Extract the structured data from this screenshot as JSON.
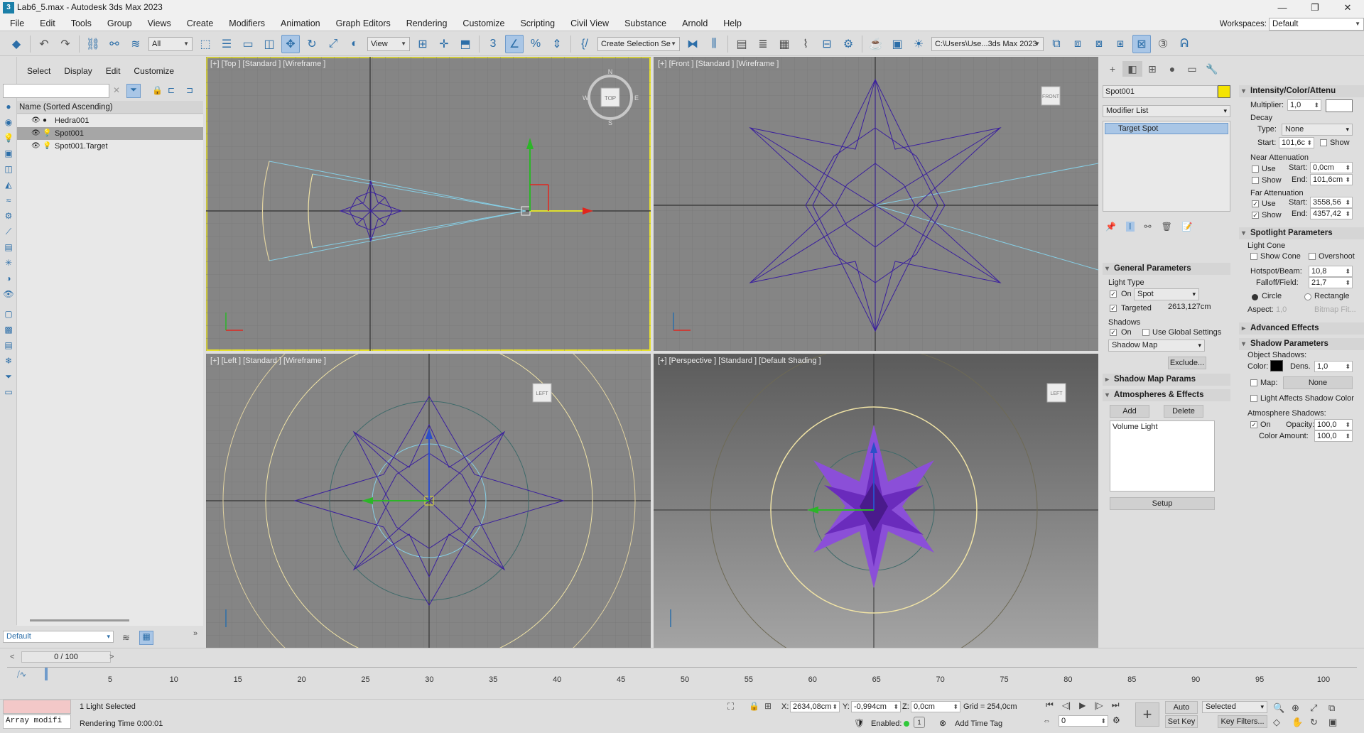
{
  "window": {
    "title": "Lab6_5.max - Autodesk 3ds Max 2023"
  },
  "menu": [
    "File",
    "Edit",
    "Tools",
    "Group",
    "Views",
    "Create",
    "Modifiers",
    "Animation",
    "Graph Editors",
    "Rendering",
    "Customize",
    "Scripting",
    "Civil View",
    "Substance",
    "Arnold",
    "Help"
  ],
  "workspace": {
    "label": "Workspaces:",
    "value": "Default"
  },
  "toolbar": {
    "filter": "All",
    "ref_coord": "View",
    "selection_set": "Create Selection Se",
    "project_path": "C:\\Users\\Use...3ds Max 2023"
  },
  "scene_explorer": {
    "tabs": [
      "Select",
      "Display",
      "Edit",
      "Customize"
    ],
    "header": "Name (Sorted Ascending)",
    "items": [
      {
        "name": "Hedra001",
        "selected": false
      },
      {
        "name": "Spot001",
        "selected": true
      },
      {
        "name": "Spot001.Target",
        "selected": false
      }
    ],
    "layer": "Default"
  },
  "viewports": {
    "top": {
      "label": "[+] [Top ] [Standard ] [Wireframe ]",
      "cube": "TOP",
      "compass": {
        "n": "N",
        "s": "S",
        "e": "E",
        "w": "W"
      }
    },
    "front": {
      "label": "[+] [Front ] [Standard ] [Wireframe ]",
      "cube": "FRONT"
    },
    "left": {
      "label": "[+] [Left ] [Standard ] [Wireframe ]",
      "cube": "LEFT"
    },
    "perspective": {
      "label": "[+] [Perspective ] [Standard ] [Default Shading ]",
      "cube": "LEFT"
    }
  },
  "command_panel": {
    "object_name": "Spot001",
    "object_color": "#f5e400",
    "modifier_list": "Modifier List",
    "stack_item": "Target Spot",
    "general": {
      "title": "General Parameters",
      "light_type": "Light Type",
      "on": "On",
      "type": "Spot",
      "targeted": "Targeted",
      "target_dist": "2613,127cm",
      "shadows": "Shadows",
      "shadows_on": "On",
      "use_global": "Use Global Settings",
      "shadow_type": "Shadow Map",
      "exclude": "Exclude..."
    },
    "rollouts_closed": [
      "Shadow Map Params"
    ],
    "atmos": {
      "title": "Atmospheres & Effects",
      "add": "Add",
      "delete": "Delete",
      "list_item": "Volume Light",
      "setup": "Setup"
    },
    "intensity": {
      "title": "Intensity/Color/Attenu",
      "multiplier_label": "Multiplier:",
      "multiplier": "1,0",
      "decay": "Decay",
      "type_label": "Type:",
      "type": "None",
      "start_label": "Start:",
      "start": "101,6c",
      "show": "Show",
      "near": "Near Attenuation",
      "near_use": "Use",
      "near_show": "Show",
      "near_start_label": "Start:",
      "near_start": "0,0cm",
      "near_end_label": "End:",
      "near_end": "101,6cm",
      "far": "Far Attenuation",
      "far_use": "Use",
      "far_show": "Show",
      "far_start_label": "Start:",
      "far_start": "3558,56",
      "far_end_label": "End:",
      "far_end": "4357,42"
    },
    "spotlight": {
      "title": "Spotlight Parameters",
      "cone": "Light Cone",
      "show_cone": "Show Cone",
      "overshoot": "Overshoot",
      "hotspot_label": "Hotspot/Beam:",
      "hotspot": "10,8",
      "falloff_label": "Falloff/Field:",
      "falloff": "21,7",
      "circle": "Circle",
      "rectangle": "Rectangle",
      "aspect_label": "Aspect:",
      "aspect": "1,0",
      "bitmap_fit": "Bitmap Fit..."
    },
    "advanced": {
      "title": "Advanced Effects"
    },
    "shadow_params": {
      "title": "Shadow Parameters",
      "object_shadows": "Object Shadows:",
      "color_label": "Color:",
      "dens_label": "Dens.",
      "dens": "1,0",
      "map_label": "Map:",
      "map": "None",
      "light_affects": "Light Affects Shadow Color",
      "atmos_shadows": "Atmosphere Shadows:",
      "on": "On",
      "opacity_label": "Opacity:",
      "opacity": "100,0",
      "color_amount_label": "Color Amount:",
      "color_amount": "100,0"
    }
  },
  "timeline": {
    "frame": "0 / 100",
    "ticks": [
      "5",
      "10",
      "15",
      "20",
      "25",
      "30",
      "35",
      "40",
      "45",
      "50",
      "55",
      "60",
      "65",
      "70",
      "75",
      "80",
      "85",
      "90",
      "95",
      "100"
    ],
    "start_tick": "0"
  },
  "status": {
    "script": "Array modifi",
    "selected": "1 Light Selected",
    "render_time": "Rendering Time  0:00:01",
    "x_label": "X:",
    "x": "2634,08cm",
    "y_label": "Y:",
    "y": "-0,994cm",
    "z_label": "Z:",
    "z": "0,0cm",
    "grid": "Grid = 254,0cm",
    "enabled": "Enabled:",
    "add_time_tag": "Add Time Tag",
    "auto_key": "Auto Key",
    "selected_dd": "Selected",
    "set_key": "Set Key",
    "key_filters": "Key Filters...",
    "frame_field": "0"
  }
}
